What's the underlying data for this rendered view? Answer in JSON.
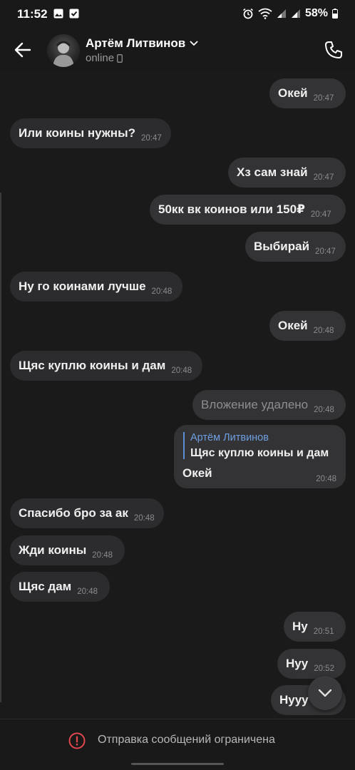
{
  "status_bar": {
    "time": "11:52",
    "battery": "58%",
    "left_icons": [
      "image-icon",
      "check-box-icon"
    ],
    "right_icons": [
      "alarm-icon",
      "wifi-icon",
      "signal-icon",
      "signal-icon",
      "battery-icon"
    ]
  },
  "header": {
    "name": "Артём Литвинов",
    "status": "online"
  },
  "messages": [
    {
      "dir": "out",
      "text": "Окей",
      "time": "20:47"
    },
    {
      "dir": "in",
      "text": "Или коины нужны?",
      "time": "20:47"
    },
    {
      "dir": "out",
      "text": "Хз сам знай",
      "time": "20:47"
    },
    {
      "dir": "out",
      "text": "50кк вк коинов или 150₽",
      "time": "20:47"
    },
    {
      "dir": "out",
      "text": "Выбирай",
      "time": "20:47"
    },
    {
      "dir": "in",
      "text": "Ну го коинами лучше",
      "time": "20:48"
    },
    {
      "dir": "out",
      "text": "Окей",
      "time": "20:48"
    },
    {
      "dir": "in",
      "text": "Щяс куплю коины и дам",
      "time": "20:48"
    },
    {
      "dir": "out",
      "text": "Вложение удалено",
      "time": "20:48"
    },
    {
      "dir": "in",
      "text": "Спасибо бро за ак",
      "time": "20:48"
    },
    {
      "dir": "in",
      "text": "Жди коины",
      "time": "20:48"
    },
    {
      "dir": "in",
      "text": "Щяс дам",
      "time": "20:48"
    },
    {
      "dir": "out",
      "text": "Ну",
      "time": "20:51"
    },
    {
      "dir": "out",
      "text": "Нуу",
      "time": "20:52"
    },
    {
      "dir": "out",
      "text": "Нууу",
      "time": ""
    }
  ],
  "reply_message": {
    "quoted_author": "Артём Литвинов",
    "quoted_text": "Щяс куплю коины и дам",
    "text": "Окей",
    "time": "20:48"
  },
  "footer": {
    "text": "Отправка сообщений ограничена"
  },
  "colors": {
    "background": "#1a1a1b",
    "bubble": "#2c2c2e",
    "accent_link": "#6e9fe0",
    "warning": "#e0474c"
  }
}
